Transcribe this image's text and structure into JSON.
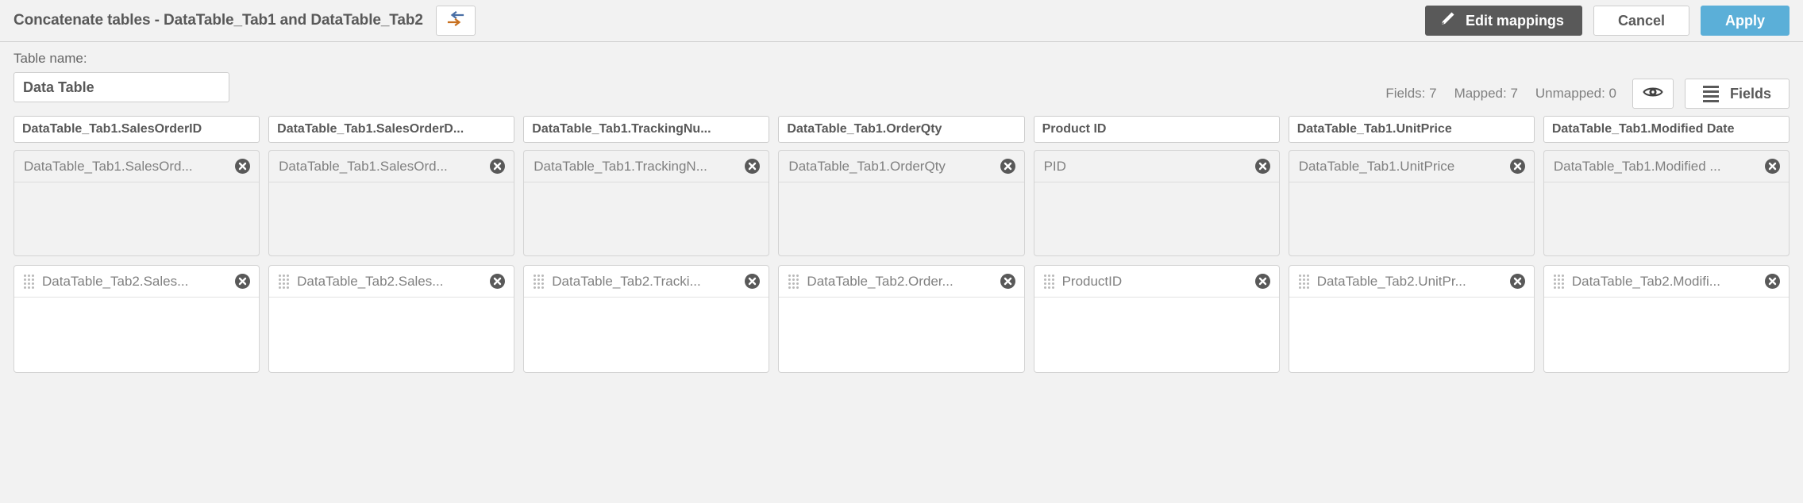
{
  "header": {
    "title": "Concatenate tables - DataTable_Tab1 and DataTable_Tab2",
    "swap_icon": "swap-arrows-icon",
    "edit_mappings_label": "Edit mappings",
    "edit_mappings_icon": "pencil-icon",
    "cancel_label": "Cancel",
    "apply_label": "Apply",
    "apply_color": "#5bafd8",
    "edit_color": "#595959"
  },
  "subbar": {
    "table_name_label": "Table name:",
    "table_name_value": "Data Table",
    "table_name_placeholder": "Table name",
    "fields_count": "Fields: 7",
    "mapped_count": "Mapped: 7",
    "unmapped_count": "Unmapped: 0",
    "preview_icon": "eye-icon",
    "fields_button_label": "Fields",
    "fields_button_icon": "hamburger-icon"
  },
  "columns": [
    {
      "header": "DataTable_Tab1.SalesOrderID",
      "row1": {
        "label": "DataTable_Tab1.SalesOrd...",
        "close_icon": "close-circle-icon"
      },
      "row2": {
        "label": "DataTable_Tab2.Sales...",
        "close_icon": "close-circle-icon",
        "drag_icon": "drag-handle-icon"
      }
    },
    {
      "header": "DataTable_Tab1.SalesOrderD...",
      "row1": {
        "label": "DataTable_Tab1.SalesOrd...",
        "close_icon": "close-circle-icon"
      },
      "row2": {
        "label": "DataTable_Tab2.Sales...",
        "close_icon": "close-circle-icon",
        "drag_icon": "drag-handle-icon"
      }
    },
    {
      "header": "DataTable_Tab1.TrackingNu...",
      "row1": {
        "label": "DataTable_Tab1.TrackingN...",
        "close_icon": "close-circle-icon"
      },
      "row2": {
        "label": "DataTable_Tab2.Tracki...",
        "close_icon": "close-circle-icon",
        "drag_icon": "drag-handle-icon"
      }
    },
    {
      "header": "DataTable_Tab1.OrderQty",
      "row1": {
        "label": "DataTable_Tab1.OrderQty",
        "close_icon": "close-circle-icon"
      },
      "row2": {
        "label": "DataTable_Tab2.Order...",
        "close_icon": "close-circle-icon",
        "drag_icon": "drag-handle-icon"
      }
    },
    {
      "header": "Product ID",
      "row1": {
        "label": "PID",
        "close_icon": "close-circle-icon"
      },
      "row2": {
        "label": "ProductID",
        "close_icon": "close-circle-icon",
        "drag_icon": "drag-handle-icon"
      }
    },
    {
      "header": "DataTable_Tab1.UnitPrice",
      "row1": {
        "label": "DataTable_Tab1.UnitPrice",
        "close_icon": "close-circle-icon"
      },
      "row2": {
        "label": "DataTable_Tab2.UnitPr...",
        "close_icon": "close-circle-icon",
        "drag_icon": "drag-handle-icon"
      }
    },
    {
      "header": "DataTable_Tab1.Modified Date",
      "row1": {
        "label": "DataTable_Tab1.Modified ...",
        "close_icon": "close-circle-icon"
      },
      "row2": {
        "label": "DataTable_Tab2.Modifi...",
        "close_icon": "close-circle-icon",
        "drag_icon": "drag-handle-icon"
      }
    }
  ]
}
